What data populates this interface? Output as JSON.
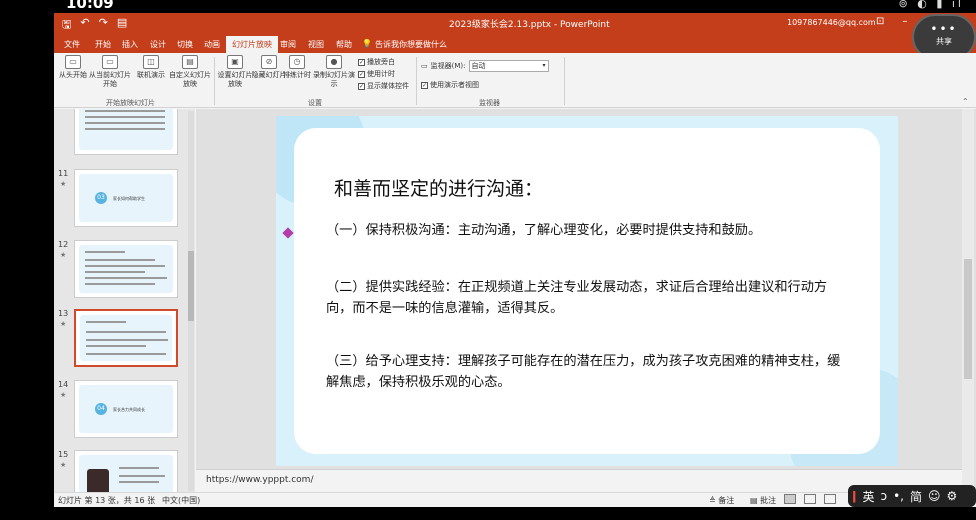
{
  "phone": {
    "time": "10:09",
    "icons": "⊚ ◐ ▮ ıl"
  },
  "window": {
    "qat": [
      "🖫",
      "↶",
      "↷",
      "▤"
    ],
    "doc_title": "2023级家长会2.13.pptx  -  PowerPoint",
    "account": "1097867446@qq.com",
    "controls": [
      "⊡",
      "–",
      "☐",
      "✕"
    ],
    "share_label": "共享"
  },
  "menu": {
    "tabs": [
      "文件",
      "开始",
      "插入",
      "设计",
      "切换",
      "动画",
      "幻灯片放映",
      "审阅",
      "视图",
      "帮助"
    ],
    "active_tab": "幻灯片放映",
    "tell_me": "告诉我你想要做什么"
  },
  "ribbon": {
    "start_group": {
      "label": "开始放映幻灯片",
      "buttons": [
        "从头开始",
        "从当前幻灯片开始",
        "联机演示",
        "自定义幻灯片放映"
      ]
    },
    "setup_group": {
      "label": "设置",
      "buttons": [
        "设置幻灯片放映",
        "隐藏幻灯片",
        "排练计时",
        "录制幻灯片演示"
      ],
      "checks": [
        "播放旁白",
        "使用计时",
        "显示媒体控件"
      ]
    },
    "monitor_group": {
      "label": "监视器",
      "monitor_label": "监视器(M):",
      "monitor_value": "自动",
      "presenter_view": "使用演示者视图"
    }
  },
  "thumbnails": [
    {
      "num": "",
      "kind": "table"
    },
    {
      "num": "11",
      "kind": "section",
      "badge": "03",
      "title": "家长如何帮助学生"
    },
    {
      "num": "12",
      "kind": "text"
    },
    {
      "num": "13",
      "kind": "text",
      "selected": true
    },
    {
      "num": "14",
      "kind": "section",
      "badge": "04",
      "title": "家长合力共同成长"
    },
    {
      "num": "15",
      "kind": "photo"
    }
  ],
  "slide": {
    "title": "和善而坚定的进行沟通：",
    "paragraphs": [
      "（一）保持积极沟通：主动沟通，了解心理变化，必要时提供支持和鼓励。",
      "（二）提供实践经验：在正规频道上关注专业发展动态，求证后合理给出建议和行动方向，而不是一味的信息灌输，适得其反。",
      "（三）给予心理支持：理解孩子可能存在的潜在压力，成为孩子攻克困难的精神支柱，缓解焦虑，保持积极乐观的心态。"
    ]
  },
  "notes_text": "https://www.ypppt.com/",
  "status": {
    "slide_info": "幻灯片 第 13 张，共 16 张",
    "language": "中文(中国)",
    "notes_btn": "≜ 备注",
    "comments_btn": "▤ 批注"
  },
  "ime": {
    "items": [
      "英",
      "ↄ",
      "•,",
      "简",
      "☺",
      "⚙"
    ]
  }
}
